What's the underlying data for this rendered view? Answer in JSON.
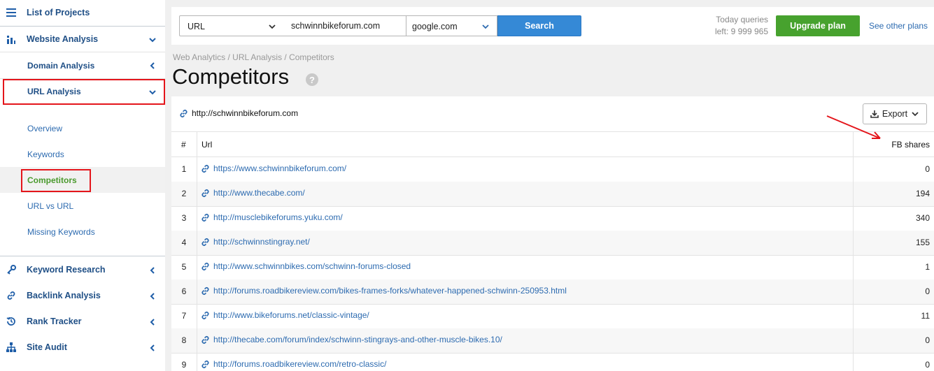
{
  "sidebar": {
    "list_of_projects": "List of Projects",
    "website_analysis": "Website Analysis",
    "domain_analysis": "Domain Analysis",
    "url_analysis": "URL Analysis",
    "sub_items": [
      "Overview",
      "Keywords",
      "Competitors",
      "URL vs URL",
      "Missing Keywords"
    ],
    "active_item": "Competitors",
    "keyword_research": "Keyword Research",
    "backlink_analysis": "Backlink Analysis",
    "rank_tracker": "Rank Tracker",
    "site_audit": "Site Audit"
  },
  "search": {
    "type_label": "URL",
    "url_value": "schwinnbikeforum.com",
    "engine_label": "google.com",
    "search_label": "Search"
  },
  "queries": {
    "line1": "Today queries",
    "line2": "left: 9 999 965"
  },
  "header": {
    "upgrade_label": "Upgrade plan",
    "see_plans_label": "See other plans"
  },
  "breadcrumb": "Web Analytics / URL Analysis / Competitors",
  "page_title": "Competitors",
  "help_glyph": "?",
  "panel": {
    "analyzed_url": "http://schwinnbikeforum.com",
    "export_label": "Export"
  },
  "table": {
    "columns": [
      "#",
      "Url",
      "FB shares"
    ],
    "rows": [
      {
        "num": "1",
        "url": "https://www.schwinnbikeforum.com/",
        "fb": "0"
      },
      {
        "num": "2",
        "url": "http://www.thecabe.com/",
        "fb": "194"
      },
      {
        "num": "3",
        "url": "http://musclebikeforums.yuku.com/",
        "fb": "340"
      },
      {
        "num": "4",
        "url": "http://schwinnstingray.net/",
        "fb": "155"
      },
      {
        "num": "5",
        "url": "http://www.schwinnbikes.com/schwinn-forums-closed",
        "fb": "1"
      },
      {
        "num": "6",
        "url": "http://forums.roadbikereview.com/bikes-frames-forks/whatever-happened-schwinn-250953.html",
        "fb": "0"
      },
      {
        "num": "7",
        "url": "http://www.bikeforums.net/classic-vintage/",
        "fb": "11"
      },
      {
        "num": "8",
        "url": "http://thecabe.com/forum/index/schwinn-stingrays-and-other-muscle-bikes.10/",
        "fb": "0"
      },
      {
        "num": "9",
        "url": "http://forums.roadbikereview.com/retro-classic/",
        "fb": "0"
      }
    ]
  },
  "colors": {
    "accent_blue": "#3589d6",
    "upgrade_green": "#47a22e",
    "highlight_red": "#e4151b",
    "active_green": "#4a9a2e"
  }
}
